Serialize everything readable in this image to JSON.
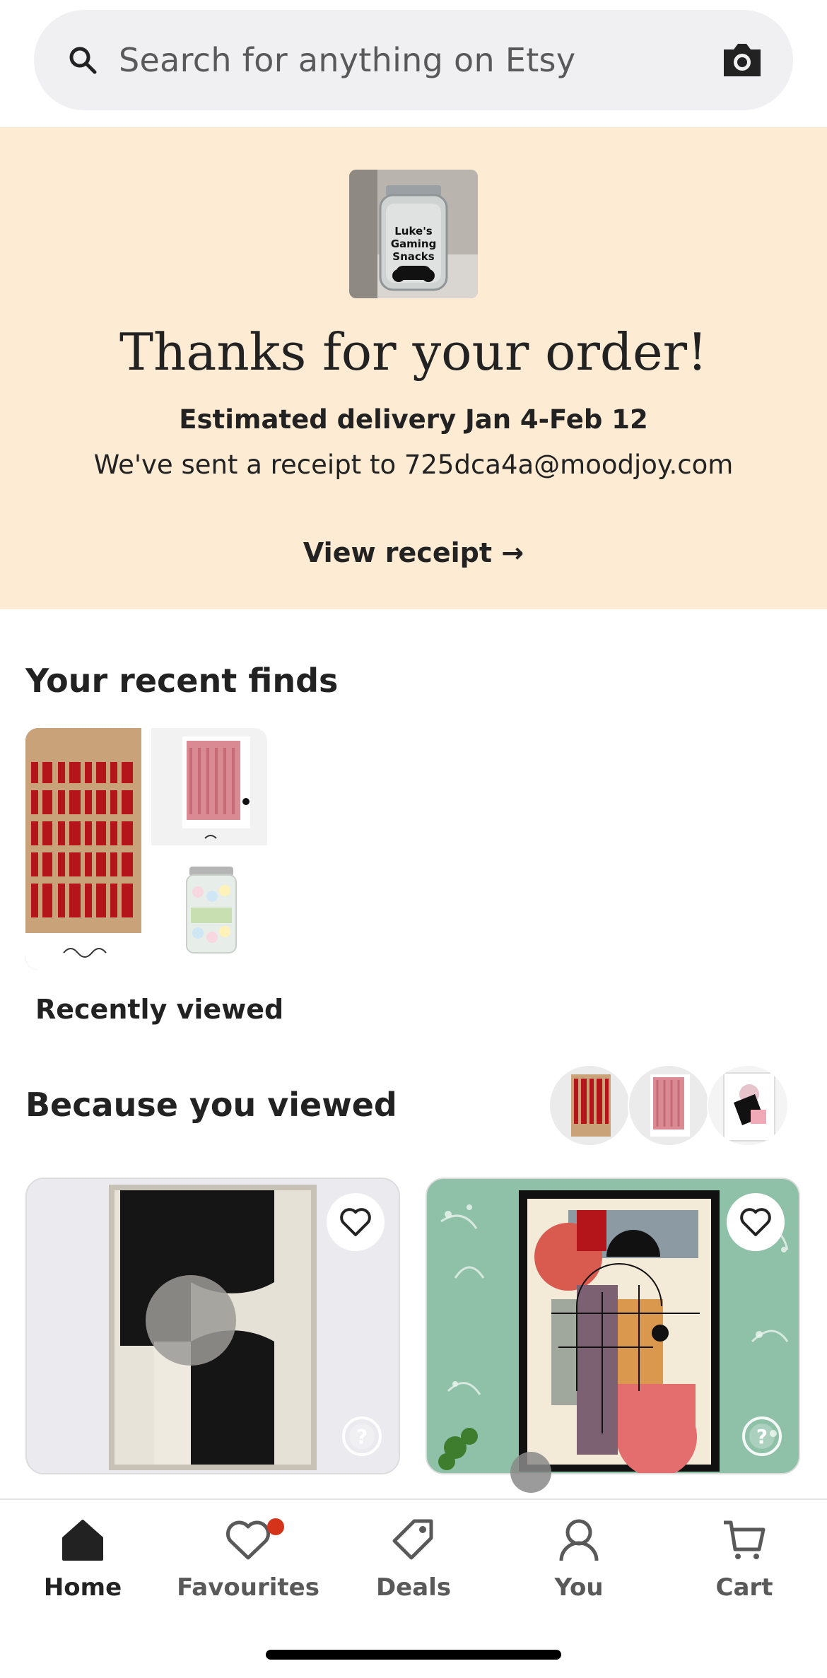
{
  "search": {
    "placeholder": "Search for anything on Etsy",
    "icon": "search-icon",
    "camera_icon": "camera-icon"
  },
  "order_banner": {
    "thumbnail_text": "Luke's Gaming Snacks",
    "title": "Thanks for your order!",
    "delivery": "Estimated delivery Jan 4-Feb 12",
    "receipt_sent": "We've sent a receipt to 725dca4a@moodjoy.com",
    "view_receipt": "View receipt →",
    "background_color": "#fdebd3"
  },
  "recent_finds": {
    "title": "Your recent finds",
    "collection_label": "Recently viewed"
  },
  "because_you_viewed": {
    "title": "Because you viewed"
  },
  "bottom_nav": {
    "items": [
      {
        "label": "Home",
        "icon": "home-icon",
        "active": true
      },
      {
        "label": "Favourites",
        "icon": "heart-icon",
        "badge": true
      },
      {
        "label": "Deals",
        "icon": "tag-icon"
      },
      {
        "label": "You",
        "icon": "person-icon"
      },
      {
        "label": "Cart",
        "icon": "cart-icon"
      }
    ]
  },
  "colors": {
    "accent_badge": "#d5341b",
    "text": "#222222",
    "muted_text": "#595959"
  }
}
